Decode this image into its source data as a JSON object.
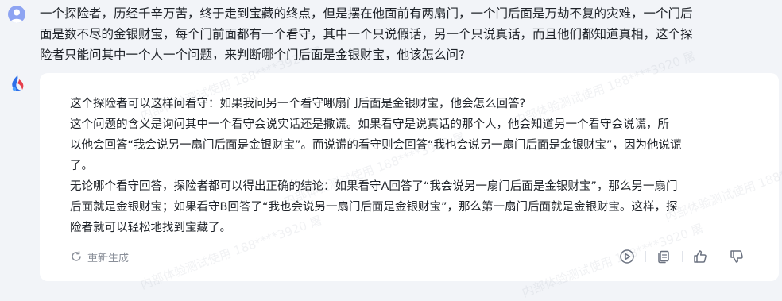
{
  "conversation": {
    "user_message": "一个探险者，历经千辛万苦，终于走到宝藏的终点，但是摆在他面前有两扇门，一个门后面是万劫不复的灾难，一个门后\n面是数不尽的金银财宝，每个门前面都有一个看守，其中一个只说假话，另一个只说真话，而且他们都知道真相，这个探\n险者只能问其中一个人一个问题，来判断哪个门后面是金银财宝，他该怎么问?",
    "assistant_reply": "这个探险者可以这样问看守：如果我问另一个看守哪扇门后面是金银财宝，他会怎么回答?\n这个问题的含义是询问其中一个看守会说实话还是撒谎。如果看守是说真话的那个人，他会知道另一个看守会说谎，所\n以他会回答“我会说另一扇门后面是金银财宝”。而说谎的看守则会回答“我也会说另一扇门后面是金银财宝”，因为他说谎\n了。\n无论哪个看守回答，探险者都可以得出正确的结论：如果看守A回答了“我会说另一扇门后面是金银财宝”，那么另一扇门\n后面就是金银财宝；如果看守B回答了“我也会说另一扇门后面是金银财宝”，那么第一扇门后面就是金银财宝。这样，探\n险者就可以轻松地找到宝藏了。",
    "regenerate_label": "重新生成"
  },
  "icons": {
    "user_avatar": "user-avatar-icon",
    "bot_avatar": "bot-logo-icon",
    "regenerate": "refresh-icon",
    "play": "play-icon",
    "copy": "copy-icon",
    "like": "thumbs-up-icon",
    "dislike": "thumbs-down-icon"
  },
  "watermark": "内部体验测试使用 188****3920 屠",
  "colors": {
    "page_bg": "#f2f4f8",
    "card_bg": "#ffffff",
    "text": "#1f2329",
    "muted": "#8a8f99",
    "icon": "#6b7280"
  }
}
